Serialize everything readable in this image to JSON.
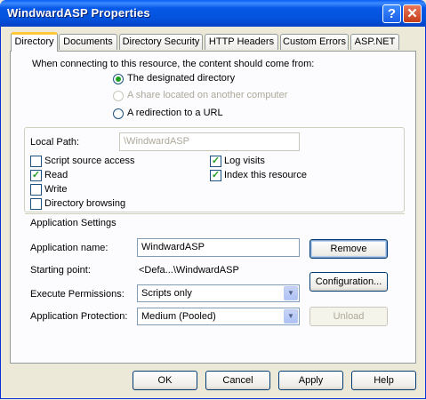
{
  "window": {
    "title": "WindwardASP Properties"
  },
  "titlebar_buttons": {
    "help": "?",
    "close": "✕"
  },
  "tabs": [
    "Directory",
    "Documents",
    "Directory Security",
    "HTTP Headers",
    "Custom Errors",
    "ASP.NET"
  ],
  "content_source": {
    "prompt": "When connecting to this resource, the content should come from:",
    "options": [
      "The designated directory",
      "A share located on another computer",
      "A redirection to a URL"
    ],
    "selected": "The designated directory"
  },
  "local_path": {
    "label": "Local Path:",
    "value": "\\WindwardASP"
  },
  "checkboxes": {
    "script_source_access": {
      "label": "Script source access",
      "checked": false
    },
    "read": {
      "label": "Read",
      "checked": true
    },
    "write": {
      "label": "Write",
      "checked": false
    },
    "directory_browsing": {
      "label": "Directory browsing",
      "checked": false
    },
    "log_visits": {
      "label": "Log visits",
      "checked": true
    },
    "index_resource": {
      "label": "Index this resource",
      "checked": true
    }
  },
  "app_settings": {
    "heading": "Application Settings",
    "name_label": "Application name:",
    "name_value": "WindwardASP",
    "start_label": "Starting point:",
    "start_value": "<Defa...\\WindwardASP",
    "exec_label": "Execute Permissions:",
    "exec_value": "Scripts only",
    "protect_label": "Application Protection:",
    "protect_value": "Medium (Pooled)",
    "remove": "Remove",
    "configuration": "Configuration...",
    "unload": "Unload"
  },
  "footer": {
    "ok": "OK",
    "cancel": "Cancel",
    "apply": "Apply",
    "help": "Help"
  }
}
